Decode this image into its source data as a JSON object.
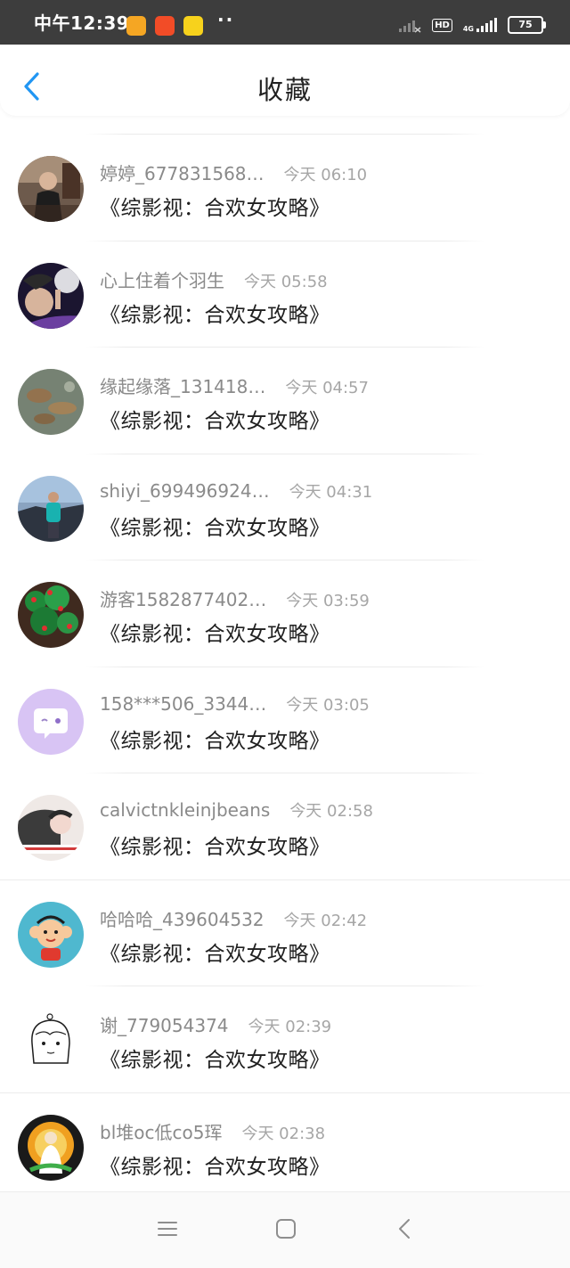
{
  "status_bar": {
    "time": "中午12:39",
    "hd": "HD",
    "network": "4G",
    "battery": "75"
  },
  "header": {
    "title": "收藏"
  },
  "items": [
    {
      "name": "婷婷_677831568…",
      "time": "今天 06:10",
      "book": "《综影视：合欢女攻略》"
    },
    {
      "name": "心上住着个羽生",
      "time": "今天 05:58",
      "book": "《综影视：合欢女攻略》"
    },
    {
      "name": "缘起缘落_131418…",
      "time": "今天 04:57",
      "book": "《综影视：合欢女攻略》"
    },
    {
      "name": "shiyi_699496924…",
      "time": "今天 04:31",
      "book": "《综影视：合欢女攻略》"
    },
    {
      "name": "游客1582877402…",
      "time": "今天 03:59",
      "book": "《综影视：合欢女攻略》"
    },
    {
      "name": "158***506_3344…",
      "time": "今天 03:05",
      "book": "《综影视：合欢女攻略》"
    },
    {
      "name": "calvictnkleinjbeans",
      "time": "今天 02:58",
      "book": "《综影视：合欢女攻略》"
    },
    {
      "name": "哈哈哈_439604532",
      "time": "今天 02:42",
      "book": "《综影视：合欢女攻略》"
    },
    {
      "name": "谢_779054374",
      "time": "今天 02:39",
      "book": "《综影视：合欢女攻略》"
    },
    {
      "name": "bl堆oc低co5珲",
      "time": "今天 02:38",
      "book": "《综影视：合欢女攻略》"
    }
  ],
  "colors": {
    "accent": "#2196f3",
    "status_bar": "#3d3d3d",
    "name_text": "#8a8a8a",
    "time_text": "#a6a6a6"
  }
}
